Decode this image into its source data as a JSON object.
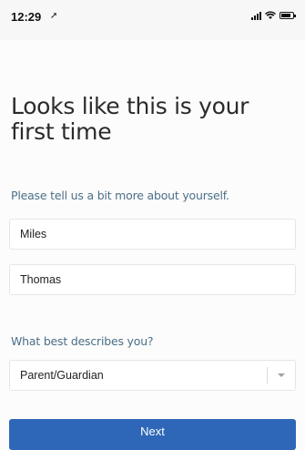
{
  "status_bar": {
    "time": "12:29",
    "location_icon": "location-arrow-icon",
    "signal_icon": "cellular-signal-icon",
    "wifi_icon": "wifi-icon",
    "battery_icon": "battery-icon"
  },
  "page": {
    "headline": "Looks like this is your first time",
    "intro": "Please tell us a bit more about yourself."
  },
  "form": {
    "first_name_value": "Miles",
    "last_name_value": "Thomas",
    "describe_label": "What best describes you?",
    "role_selected": "Parent/Guardian",
    "next_label": "Next"
  },
  "colors": {
    "accent": "#2f67b8",
    "label": "#4a6f87"
  }
}
